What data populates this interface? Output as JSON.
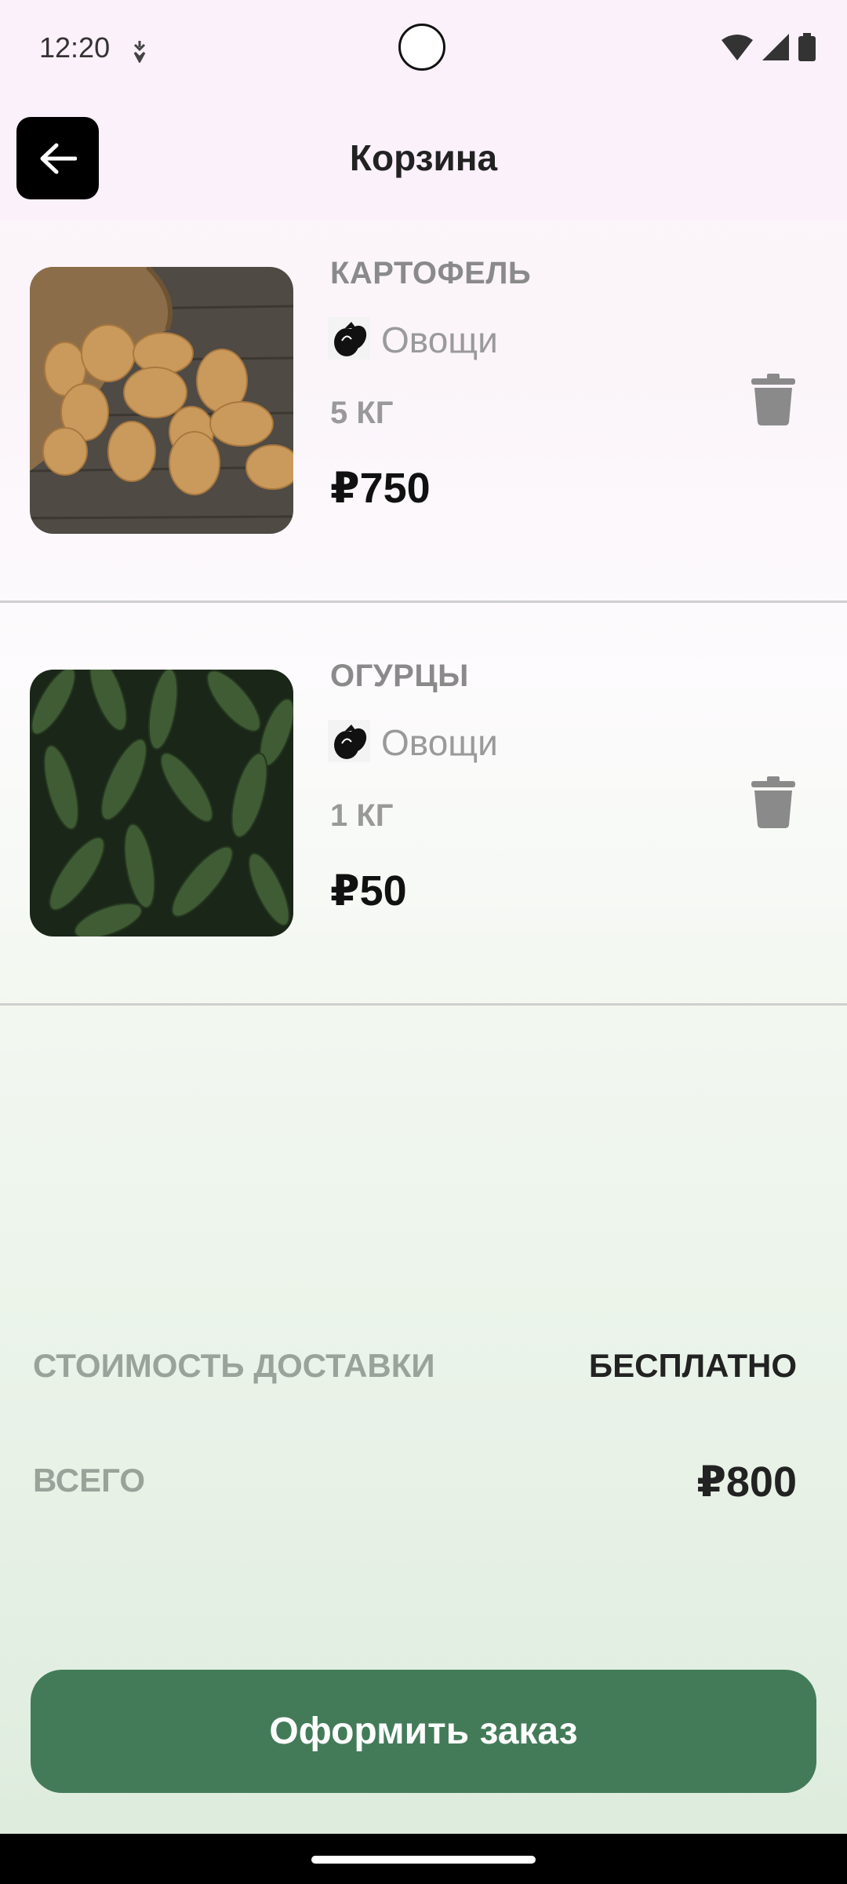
{
  "status": {
    "time": "12:20"
  },
  "header": {
    "title": "Корзина"
  },
  "cart": {
    "items": [
      {
        "name": "КАРТОФЕЛЬ",
        "category": "Овощи",
        "quantity": "5 КГ",
        "price": "₽750",
        "image": "potatoes-photo"
      },
      {
        "name": "ОГУРЦЫ",
        "category": "Овощи",
        "quantity": "1 КГ",
        "price": "₽50",
        "image": "cucumbers-photo"
      }
    ]
  },
  "summary": {
    "delivery_label": "СТОИМОСТЬ ДОСТАВКИ",
    "delivery_value": "БЕСПЛАТНО",
    "total_label": "ВСЕГО",
    "total_value": "₽800"
  },
  "actions": {
    "checkout_label": "Оформить заказ"
  },
  "colors": {
    "accent": "#437b59",
    "header_bg": "#fbf1fa"
  }
}
